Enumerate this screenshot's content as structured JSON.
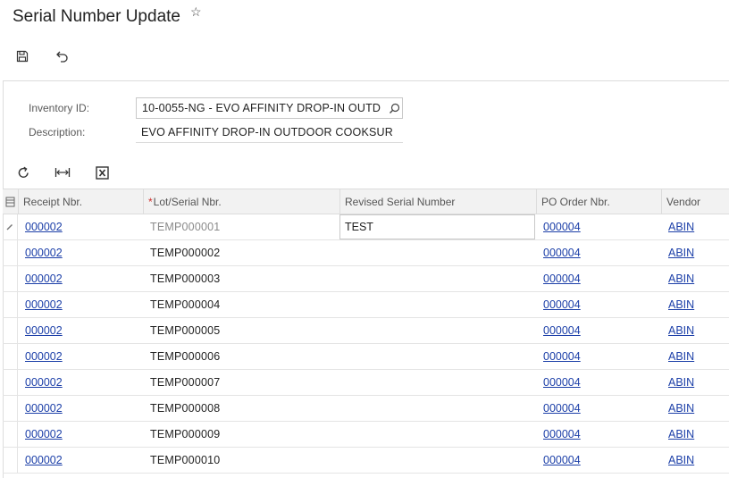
{
  "header": {
    "title": "Serial Number Update",
    "star_icon": "star-outline-icon"
  },
  "toolbar": {
    "save_icon": "save-icon",
    "undo_icon": "undo-icon"
  },
  "form": {
    "inventory_id_label": "Inventory ID:",
    "inventory_id_value": "10-0055-NG - EVO AFFINITY DROP-IN OUTD",
    "description_label": "Description:",
    "description_value": "EVO AFFINITY DROP-IN OUTDOOR COOKSUR"
  },
  "grid_toolbar": {
    "refresh_icon": "refresh-icon",
    "fit_columns_icon": "fit-columns-icon",
    "excel_icon": "excel-export-icon"
  },
  "grid": {
    "columns": [
      "Receipt Nbr.",
      "Lot/Serial Nbr.",
      "Revised Serial Number",
      "PO Order Nbr.",
      "Vendor"
    ],
    "rows": [
      {
        "receipt": "000002",
        "serial": "TEMP000001",
        "revised": "TEST",
        "po": "000004",
        "vendor": "ABIN"
      },
      {
        "receipt": "000002",
        "serial": "TEMP000002",
        "revised": "",
        "po": "000004",
        "vendor": "ABIN"
      },
      {
        "receipt": "000002",
        "serial": "TEMP000003",
        "revised": "",
        "po": "000004",
        "vendor": "ABIN"
      },
      {
        "receipt": "000002",
        "serial": "TEMP000004",
        "revised": "",
        "po": "000004",
        "vendor": "ABIN"
      },
      {
        "receipt": "000002",
        "serial": "TEMP000005",
        "revised": "",
        "po": "000004",
        "vendor": "ABIN"
      },
      {
        "receipt": "000002",
        "serial": "TEMP000006",
        "revised": "",
        "po": "000004",
        "vendor": "ABIN"
      },
      {
        "receipt": "000002",
        "serial": "TEMP000007",
        "revised": "",
        "po": "000004",
        "vendor": "ABIN"
      },
      {
        "receipt": "000002",
        "serial": "TEMP000008",
        "revised": "",
        "po": "000004",
        "vendor": "ABIN"
      },
      {
        "receipt": "000002",
        "serial": "TEMP000009",
        "revised": "",
        "po": "000004",
        "vendor": "ABIN"
      },
      {
        "receipt": "000002",
        "serial": "TEMP000010",
        "revised": "",
        "po": "000004",
        "vendor": "ABIN"
      }
    ]
  },
  "colors": {
    "link": "#1c3fa8",
    "required": "#d0312d",
    "header_bg": "#f2f2f2"
  }
}
